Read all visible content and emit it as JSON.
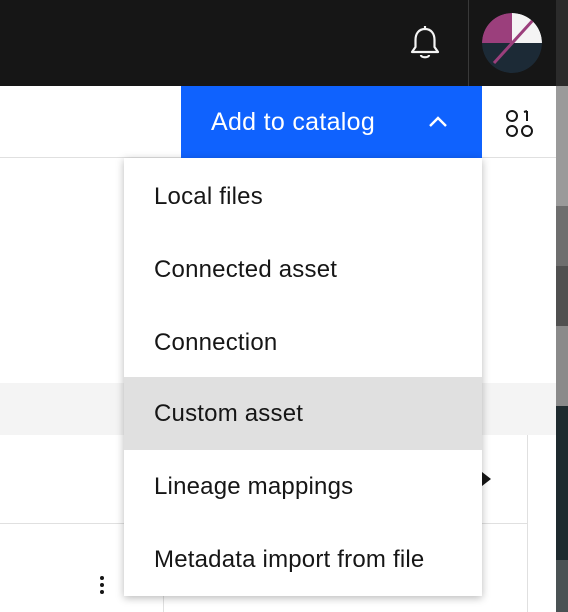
{
  "header": {
    "notification_icon": "bell-icon",
    "avatar_colors": [
      "#9b3f7c",
      "#f4f4f4",
      "#1c2a36"
    ]
  },
  "toolbar": {
    "add_to_catalog_label": "Add to catalog",
    "chevron_icon": "chevron-up-icon",
    "view_switcher_icon": "view-switcher-icon",
    "accent_color": "#0f62fe"
  },
  "menu": {
    "items": [
      {
        "label": "Local files"
      },
      {
        "label": "Connected asset"
      },
      {
        "label": "Connection"
      },
      {
        "label": "Custom asset",
        "highlighted": true
      },
      {
        "label": "Lineage mappings"
      },
      {
        "label": "Metadata import from file"
      }
    ]
  }
}
